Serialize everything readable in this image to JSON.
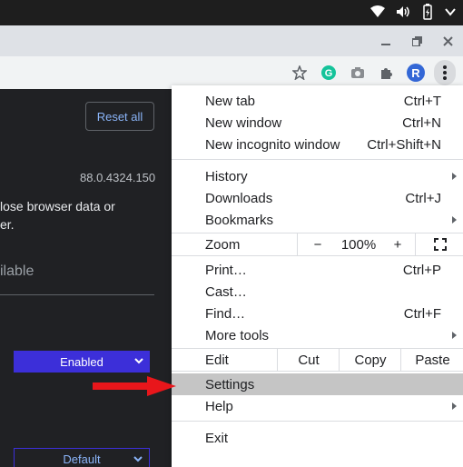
{
  "browser": {
    "toolbar_icons": [
      "star-icon",
      "grammarly-icon",
      "camera-icon",
      "extensions-icon",
      "profile-avatar",
      "more-menu-icon"
    ],
    "profile_initial": "R",
    "window_controls": [
      "minimize-icon",
      "restore-icon",
      "close-icon"
    ],
    "system_icons": [
      "wifi-icon",
      "volume-icon",
      "battery-icon",
      "dropdown-icon"
    ]
  },
  "page": {
    "reset_button": "Reset all",
    "version": "88.0.4324.150",
    "desc_line1": "lose browser data or",
    "desc_line2": "er.",
    "available_heading": "ilable",
    "enabled_select": "Enabled",
    "default_select": "Default"
  },
  "menu": {
    "new_tab": {
      "label": "New tab",
      "shortcut": "Ctrl+T"
    },
    "new_window": {
      "label": "New window",
      "shortcut": "Ctrl+N"
    },
    "new_incognito": {
      "label": "New incognito window",
      "shortcut": "Ctrl+Shift+N"
    },
    "history": {
      "label": "History"
    },
    "downloads": {
      "label": "Downloads",
      "shortcut": "Ctrl+J"
    },
    "bookmarks": {
      "label": "Bookmarks"
    },
    "zoom": {
      "label": "Zoom",
      "minus": "−",
      "value": "100%",
      "plus": "+"
    },
    "print": {
      "label": "Print…",
      "shortcut": "Ctrl+P"
    },
    "cast": {
      "label": "Cast…"
    },
    "find": {
      "label": "Find…",
      "shortcut": "Ctrl+F"
    },
    "more_tools": {
      "label": "More tools"
    },
    "edit": {
      "label": "Edit",
      "cut": "Cut",
      "copy": "Copy",
      "paste": "Paste"
    },
    "settings": {
      "label": "Settings"
    },
    "help": {
      "label": "Help"
    },
    "exit": {
      "label": "Exit"
    }
  },
  "colors": {
    "accent_purple": "#3c2fd9",
    "highlight": "#c5c5c5",
    "arrow_red": "#e8161b",
    "page_dark": "#202124"
  }
}
